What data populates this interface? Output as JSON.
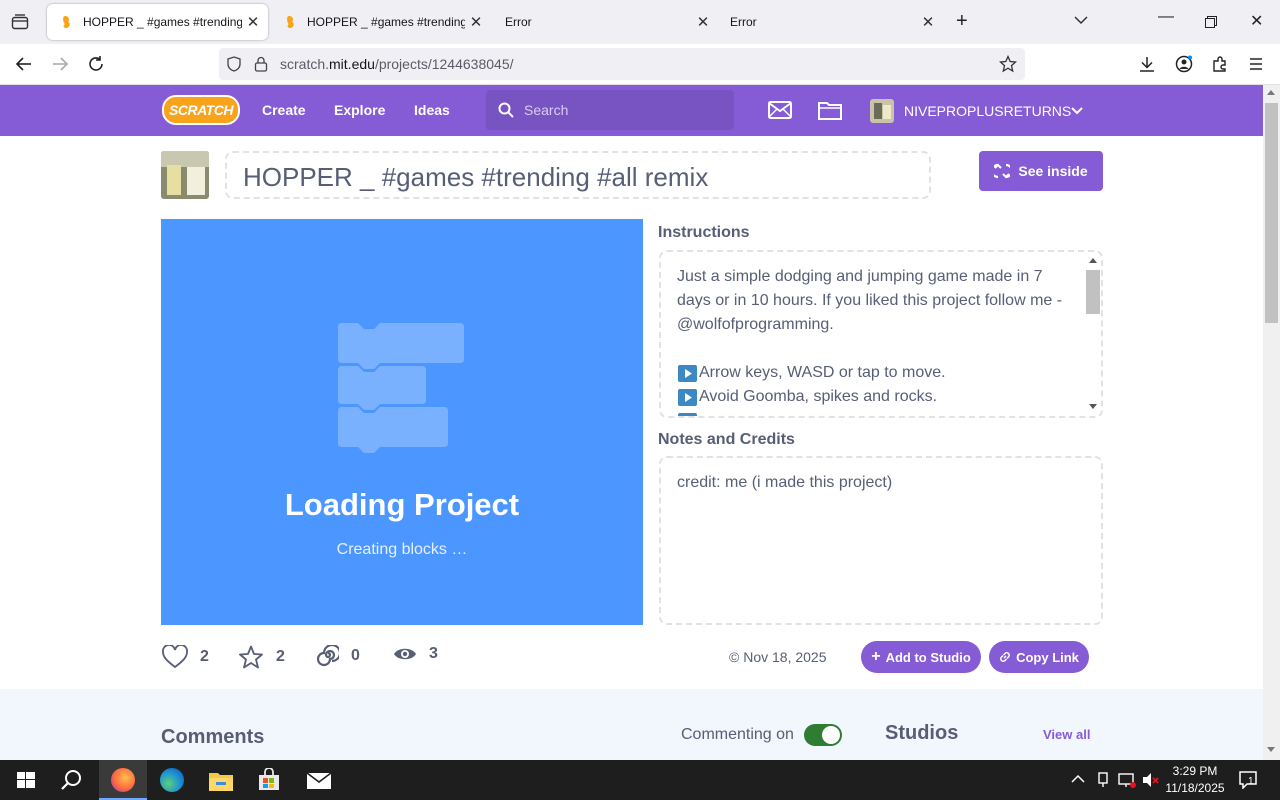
{
  "browser": {
    "tabs": [
      {
        "label": "HOPPER _ #games #trending #all",
        "active": true
      },
      {
        "label": "HOPPER _ #games #trending #all",
        "active": false
      },
      {
        "label": "Error",
        "active": false
      },
      {
        "label": "Error",
        "active": false
      }
    ],
    "url_prefix": "scratch.",
    "url_domain": "mit.edu",
    "url_path": "/projects/1244638045/"
  },
  "scratch_nav": {
    "create": "Create",
    "explore": "Explore",
    "ideas": "Ideas",
    "search_placeholder": "Search",
    "username": "NIVEPROPLUSRETURNS",
    "logo_text": "SCRATCH"
  },
  "project": {
    "title": "HOPPER _ #games #trending #all remix",
    "see_inside": "See inside",
    "loading_title": "Loading Project",
    "loading_sub": "Creating blocks …",
    "instructions_heading": "Instructions",
    "instructions_lines": [
      "Just a simple dodging and jumping game made in 7",
      "days or in 10 hours. If you liked this project follow me -",
      "@wolfofprogramming.",
      "",
      "Arrow keys, WASD or tap to move.",
      "Avoid Goomba, spikes and rocks."
    ],
    "notes_heading": "Notes and Credits",
    "notes_text": "credit: me (i made this project)",
    "stats": {
      "loves": "2",
      "favorites": "2",
      "remixes": "0",
      "views": "3"
    },
    "date": "Nov 18, 2025",
    "add_to_studio": "Add to Studio",
    "copy_link": "Copy Link"
  },
  "lower": {
    "comments_heading": "Comments",
    "commenting_label": "Commenting on",
    "commenting_on": true,
    "studios_heading": "Studios",
    "view_all": "View all"
  },
  "taskbar": {
    "time": "3:29 PM",
    "date": "11/18/2025",
    "notification_count": "1"
  },
  "colors": {
    "scratch_purple": "#855cd6",
    "stage_blue": "#4c97ff",
    "toggle_green": "#2e7d32"
  }
}
